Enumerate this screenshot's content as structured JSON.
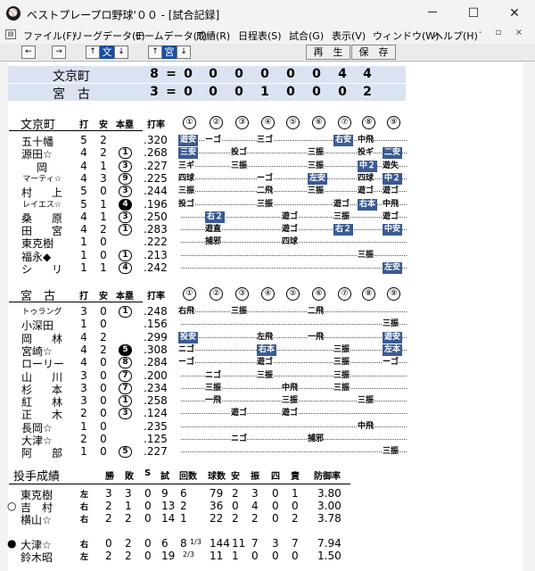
{
  "window": {
    "title": "ベストプレープロ野球'００ - [試合記録]",
    "icon": "baseball-icon",
    "minimize": "－",
    "maximize": "☐",
    "close": "✕"
  },
  "menu": [
    "ファイル(F)",
    "リーグデータ(L)",
    "チームデータ(T)",
    "成績(R)",
    "日程表(S)",
    "試合(G)",
    "表示(V)",
    "ウィンドウ(W)",
    "ヘルプ(H)"
  ],
  "mdi_controls": "- ▫ ×",
  "toolbar": {
    "prev": "←",
    "next": "→",
    "up": "↑",
    "down": "↓",
    "team1": "文",
    "team2": "宮",
    "play": "再　生",
    "save": "保　存"
  },
  "linescore": [
    {
      "team": "文京町",
      "runs": "8",
      "eq": "=",
      "innings": [
        "0",
        "0",
        "0",
        "0",
        "0",
        "0",
        "4",
        "4"
      ]
    },
    {
      "team": "宮　古",
      "runs": "3",
      "eq": "=",
      "innings": [
        "0",
        "0",
        "0",
        "1",
        "0",
        "0",
        "0",
        "2"
      ]
    }
  ],
  "batting_header": {
    "at_bats": "打",
    "hits": "安",
    "hr": "本塁",
    "avg": "打率",
    "innings": [
      "①",
      "②",
      "③",
      "④",
      "⑤",
      "⑥",
      "⑦",
      "⑧",
      "⑨"
    ]
  },
  "teams": [
    {
      "name": "文京町",
      "batters": [
        {
          "name": "五十幡",
          "ab": "5",
          "h": "2",
          "hr": "",
          "hr_dark": false,
          "avg": ".320",
          "cells": [
            {
              "t": "遊安",
              "hl": true
            },
            "ーゴ",
            "",
            "三ゴ",
            "",
            "",
            "右安hl",
            "中飛",
            ""
          ]
        },
        {
          "name": "源田☆",
          "ab": "4",
          "h": "2",
          "hr": "1",
          "hr_dark": false,
          "avg": ".268",
          "cells": [
            "三安hl",
            "",
            "投ゴ",
            "",
            "",
            "三振",
            "",
            "投ギ",
            "二安hl"
          ]
        },
        {
          "name": "岡",
          "ab": "4",
          "h": "1",
          "hr": "3",
          "hr_dark": false,
          "avg": ".227",
          "cells": [
            "三ギ",
            "",
            "三振",
            "",
            "",
            "三振",
            "",
            "中２hl",
            "遊失"
          ]
        },
        {
          "name": "マーティ☆",
          "ab": "4",
          "h": "3",
          "hr": "9",
          "hr_dark": false,
          "avg": ".225",
          "cells": [
            "四球",
            "",
            "",
            "ーゴ",
            "",
            "左安hl",
            "",
            "四球",
            "中２hl"
          ]
        },
        {
          "name": "村　上",
          "ab": "5",
          "h": "0",
          "hr": "3",
          "hr_dark": false,
          "avg": ".244",
          "cells": [
            "三振",
            "",
            "",
            "二飛",
            "",
            "三振",
            "",
            "遊ゴ",
            "遊ゴ"
          ]
        },
        {
          "name": "レイエス☆",
          "ab": "5",
          "h": "1",
          "hr": "4",
          "hr_dark": true,
          "avg": ".196",
          "cells": [
            "投ゴ",
            "",
            "",
            "三振",
            "",
            "",
            "遊ゴ",
            "右本hl",
            "中飛"
          ]
        },
        {
          "name": "桑　原",
          "ab": "4",
          "h": "1",
          "hr": "3",
          "hr_dark": false,
          "avg": ".250",
          "cells": [
            "",
            "右２hl",
            "",
            "",
            "遊ゴ",
            "",
            "三振",
            "",
            "遊ゴ"
          ]
        },
        {
          "name": "田　宮",
          "ab": "4",
          "h": "2",
          "hr": "1",
          "hr_dark": false,
          "avg": ".283",
          "cells": [
            "",
            "遊直",
            "",
            "",
            "遊ゴ",
            "",
            "右２hl",
            "",
            "中安hl"
          ]
        },
        {
          "name": "東克樹",
          "ab": "1",
          "h": "0",
          "hr": "",
          "hr_dark": false,
          "avg": ".222",
          "cells": [
            "",
            "捕邪",
            "",
            "",
            "四球",
            "",
            "",
            "",
            ""
          ]
        },
        {
          "name": "福永◆",
          "ab": "1",
          "h": "0",
          "hr": "1",
          "hr_dark": false,
          "avg": ".213",
          "cells": [
            "",
            "",
            "",
            "",
            "",
            "",
            "",
            "三振",
            ""
          ]
        },
        {
          "name": "シ　リ",
          "ab": "1",
          "h": "1",
          "hr": "4",
          "hr_dark": false,
          "avg": ".242",
          "cells": [
            "",
            "",
            "",
            "",
            "",
            "",
            "",
            "",
            "左安hl"
          ]
        }
      ]
    },
    {
      "name": "宮　古",
      "batters": [
        {
          "name": "トゥラング",
          "ab": "3",
          "h": "0",
          "hr": "1",
          "hr_dark": false,
          "avg": ".248",
          "cells": [
            "右飛",
            "",
            "三振",
            "",
            "",
            "二飛",
            "",
            "",
            ""
          ]
        },
        {
          "name": "小深田",
          "ab": "1",
          "h": "0",
          "hr": "",
          "hr_dark": false,
          "avg": ".156",
          "cells": [
            "",
            "",
            "",
            "",
            "",
            "",
            "",
            "",
            "三振"
          ]
        },
        {
          "name": "岡　林",
          "ab": "4",
          "h": "2",
          "hr": "",
          "hr_dark": false,
          "avg": ".299",
          "cells": [
            "投安hl",
            "",
            "",
            "左飛",
            "",
            "一飛",
            "",
            "",
            "遊安hl"
          ]
        },
        {
          "name": "宮崎☆",
          "ab": "4",
          "h": "2",
          "hr": "5",
          "hr_dark": true,
          "avg": ".308",
          "cells": [
            "ニゴ",
            "",
            "",
            "右本hl",
            "",
            "",
            "三振",
            "",
            "左本hl"
          ]
        },
        {
          "name": "ローリー",
          "ab": "4",
          "h": "0",
          "hr": "8",
          "hr_dark": false,
          "avg": ".284",
          "cells": [
            "ーゴ",
            "",
            "",
            "遊ゴ",
            "",
            "",
            "三振",
            "",
            "ーゴ"
          ]
        },
        {
          "name": "山　川",
          "ab": "3",
          "h": "0",
          "hr": "7",
          "hr_dark": false,
          "avg": ".200",
          "cells": [
            "",
            "ニゴ",
            "",
            "三振",
            "",
            "",
            "三振",
            "",
            ""
          ]
        },
        {
          "name": "杉　本",
          "ab": "3",
          "h": "0",
          "hr": "7",
          "hr_dark": false,
          "avg": ".234",
          "cells": [
            "",
            "三振",
            "",
            "",
            "中飛",
            "",
            "三振",
            "",
            ""
          ]
        },
        {
          "name": "紅　林",
          "ab": "3",
          "h": "0",
          "hr": "1",
          "hr_dark": false,
          "avg": ".258",
          "cells": [
            "",
            "一飛",
            "",
            "",
            "三振",
            "",
            "",
            "三振",
            ""
          ]
        },
        {
          "name": "正　木",
          "ab": "2",
          "h": "0",
          "hr": "3",
          "hr_dark": false,
          "avg": ".124",
          "cells": [
            "",
            "",
            "遊ゴ",
            "",
            "遊ゴ",
            "",
            "",
            "",
            ""
          ]
        },
        {
          "name": "長岡☆",
          "ab": "1",
          "h": "0",
          "hr": "",
          "hr_dark": false,
          "avg": ".235",
          "cells": [
            "",
            "",
            "",
            "",
            "",
            "",
            "",
            "中飛",
            ""
          ]
        },
        {
          "name": "大津☆",
          "ab": "2",
          "h": "0",
          "hr": "",
          "hr_dark": false,
          "avg": ".125",
          "cells": [
            "",
            "",
            "ニゴ",
            "",
            "",
            "捕邪",
            "",
            "",
            ""
          ]
        },
        {
          "name": "阿　部",
          "ab": "1",
          "h": "0",
          "hr": "5",
          "hr_dark": false,
          "avg": ".227",
          "cells": [
            "",
            "",
            "",
            "",
            "",
            "",
            "",
            "",
            "三振"
          ]
        }
      ]
    }
  ],
  "pitching": {
    "title": "投手成績",
    "header": [
      "勝",
      "敗",
      "S",
      "試",
      "回数",
      "球数",
      "安",
      "振",
      "四",
      "責",
      "防御率"
    ],
    "groups": [
      [
        {
          "mark": "",
          "name": "東克樹",
          "hand": "左",
          "w": "3",
          "l": "3",
          "s": "0",
          "g": "9",
          "ip": "6",
          "ip_frac": "",
          "pitches": "79",
          "h": "2",
          "k": "3",
          "bb": "0",
          "er": "1",
          "era": "3.80"
        },
        {
          "mark": "○",
          "name": "吉　村",
          "hand": "右",
          "w": "2",
          "l": "1",
          "s": "0",
          "g": "13",
          "ip": "2",
          "ip_frac": "",
          "pitches": "36",
          "h": "0",
          "k": "4",
          "bb": "0",
          "er": "0",
          "era": "3.00"
        },
        {
          "mark": "",
          "name": "横山☆",
          "hand": "右",
          "w": "2",
          "l": "2",
          "s": "0",
          "g": "14",
          "ip": "1",
          "ip_frac": "",
          "pitches": "22",
          "h": "2",
          "k": "2",
          "bb": "0",
          "er": "2",
          "era": "3.78"
        }
      ],
      [
        {
          "mark": "●",
          "name": "大津☆",
          "hand": "右",
          "w": "0",
          "l": "2",
          "s": "0",
          "g": "6",
          "ip": "8",
          "ip_frac": "1/3",
          "pitches": "144",
          "h": "11",
          "k": "7",
          "bb": "3",
          "er": "7",
          "era": "7.94"
        },
        {
          "mark": "",
          "name": "鈴木昭",
          "hand": "左",
          "w": "2",
          "l": "2",
          "s": "0",
          "g": "19",
          "ip": "",
          "ip_frac": "2/3",
          "pitches": "11",
          "h": "1",
          "k": "0",
          "bb": "0",
          "er": "0",
          "era": "1.50"
        }
      ]
    ]
  },
  "colors": {
    "highlight": "#3a5b92",
    "linescore_bg": "#dbe3f2",
    "toolbar_blue": "#1a4d9f"
  }
}
